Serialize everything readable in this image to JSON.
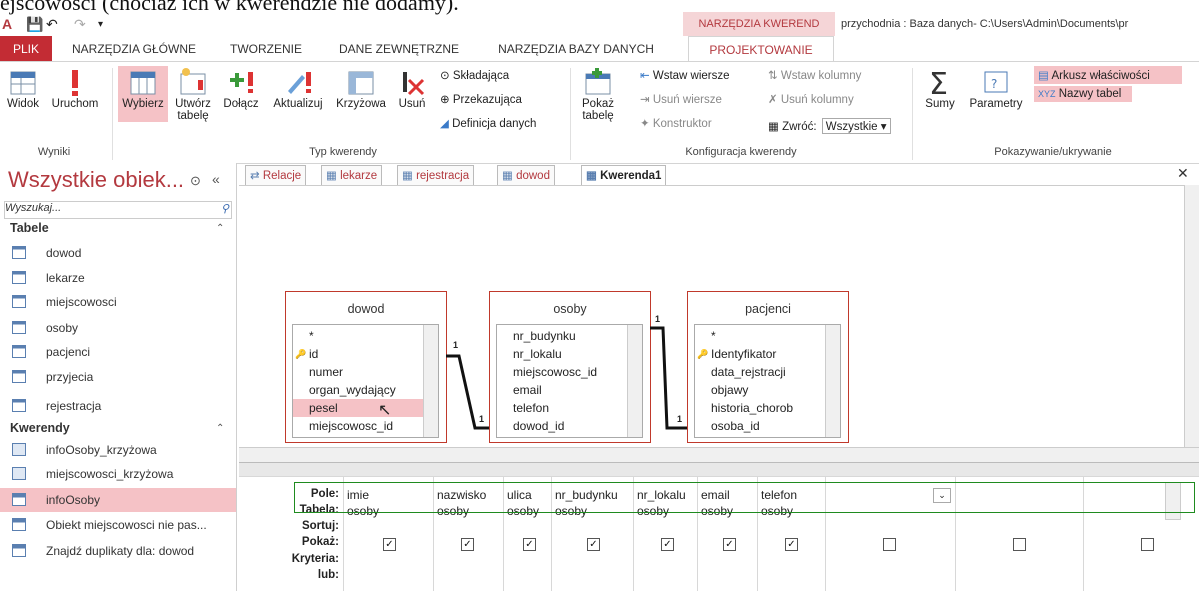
{
  "caption": "ejscowości (chociaż ich w kwerendzie nie dodamy).",
  "window": {
    "context_group": "NARZĘDZIA KWEREND",
    "title": "przychodnia : Baza danych- C:\\Users\\Admin\\Documents\\pr"
  },
  "ribbon_tabs": [
    "PLIK",
    "NARZĘDZIA GŁÓWNE",
    "TWORZENIE",
    "DANE ZEWNĘTRZNE",
    "NARZĘDZIA BAZY DANYCH",
    "PROJEKTOWANIE"
  ],
  "ribbon": {
    "widok": "Widok",
    "uruchom": "Uruchom",
    "wybierz": "Wybierz",
    "utworz_line1": "Utwórz",
    "utworz_line2": "tabelę",
    "dolacz": "Dołącz",
    "aktualizuj": "Aktualizuj",
    "krzyzowa": "Krzyżowa",
    "usun": "Usuń",
    "skladajaca": "Składająca",
    "przekazujaca": "Przekazująca",
    "definicja": "Definicja danych",
    "pokaz_line1": "Pokaż",
    "pokaz_line2": "tabelę",
    "wstaw_wiersze": "Wstaw wiersze",
    "usun_wiersze": "Usuń wiersze",
    "konstruktor": "Konstruktor",
    "wstaw_kolumny": "Wstaw kolumny",
    "usun_kolumny": "Usuń kolumny",
    "zwroc": "Zwróć:",
    "zwroc_value": "Wszystkie",
    "sumy": "Sumy",
    "parametry": "Parametry",
    "arkusz": "Arkusz właściwości",
    "nazwy": "Nazwy tabel",
    "groups": {
      "wyniki": "Wyniki",
      "typ": "Typ kwerendy",
      "konfiguracja": "Konfiguracja kwerendy",
      "pokazywanie": "Pokazywanie/ukrywanie"
    }
  },
  "nav": {
    "title": "Wszystkie obiek...",
    "search_placeholder": "Wyszukaj...",
    "tables_header": "Tabele",
    "tables": [
      "dowod",
      "lekarze",
      "miejscowosci",
      "osoby",
      "pacjenci",
      "przyjecia",
      "rejestracja"
    ],
    "queries_header": "Kwerendy",
    "queries": [
      "infoOsoby_krzyżowa",
      "miejscowosci_krzyżowa",
      "infoOsoby",
      "Obiekt miejscowosci nie pas...",
      "Znajdź duplikaty dla: dowod"
    ],
    "selected_query": "infoOsoby"
  },
  "doc_tabs": [
    "Relacje",
    "lekarze",
    "rejestracja",
    "dowod",
    "Kwerenda1"
  ],
  "active_doc_tab": "Kwerenda1",
  "tables": [
    {
      "name": "dowod",
      "fields": [
        "*",
        "id",
        "numer",
        "organ_wydający",
        "pesel",
        "miejscowosc_id"
      ],
      "key": "id",
      "highlighted": "pesel"
    },
    {
      "name": "osoby",
      "fields": [
        "nr_budynku",
        "nr_lokalu",
        "miejscowosc_id",
        "email",
        "telefon",
        "dowod_id"
      ]
    },
    {
      "name": "pacjenci",
      "fields": [
        "*",
        "Identyfikator",
        "data_rejstracji",
        "objawy",
        "historia_chorob",
        "osoba_id"
      ],
      "key": "Identyfikator"
    }
  ],
  "relation_label": "1",
  "grid": {
    "row_labels": [
      "Pole:",
      "Tabela:",
      "Sortuj:",
      "Pokaż:",
      "Kryteria:",
      "lub:"
    ],
    "columns": [
      {
        "field": "imie",
        "table": "osoby",
        "show": true
      },
      {
        "field": "nazwisko",
        "table": "osoby",
        "show": true
      },
      {
        "field": "ulica",
        "table": "osoby",
        "show": true
      },
      {
        "field": "nr_budynku",
        "table": "osoby",
        "show": true
      },
      {
        "field": "nr_lokalu",
        "table": "osoby",
        "show": true
      },
      {
        "field": "email",
        "table": "osoby",
        "show": true
      },
      {
        "field": "telefon",
        "table": "osoby",
        "show": true
      },
      {
        "field": "",
        "table": "",
        "show": false
      },
      {
        "field": "",
        "table": "",
        "show": false
      },
      {
        "field": "",
        "table": "",
        "show": false
      }
    ]
  },
  "colors": {
    "accent": "#b3393f",
    "highlight": "#f5c2c6",
    "green_box": "#1f8b1f"
  }
}
